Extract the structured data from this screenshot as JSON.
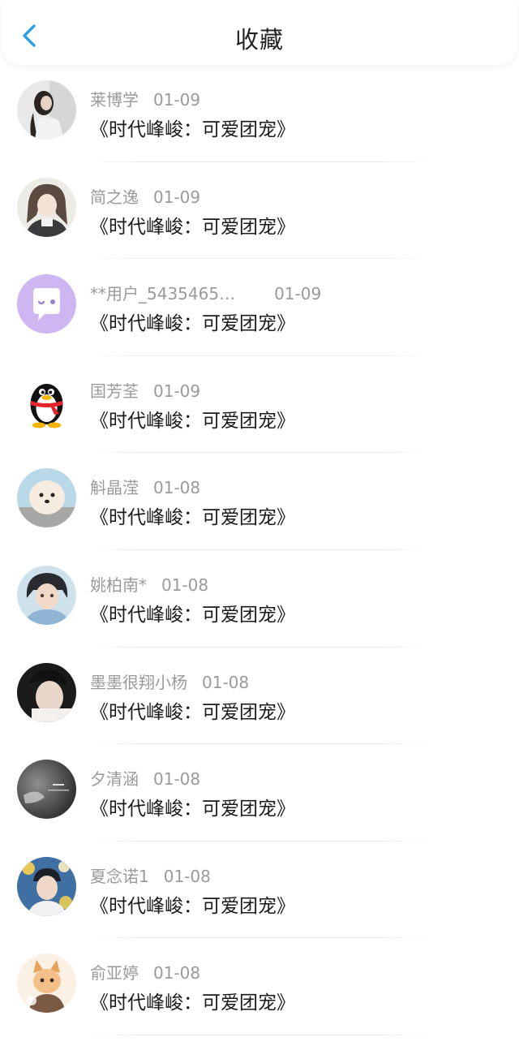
{
  "header": {
    "title": "收藏",
    "back_icon": "chevron-left-icon",
    "accent_color": "#2a9fe8"
  },
  "favorites": [
    {
      "user": "莱博学",
      "date": "01-09",
      "book": "《时代峰峻：可爱团宠》",
      "avatar": "photo-avatar"
    },
    {
      "user": "简之逸",
      "date": "01-09",
      "book": "《时代峰峻：可爱团宠》",
      "avatar": "illustration-avatar"
    },
    {
      "user": "**用户_5435465…",
      "date": "01-09",
      "book": "《时代峰峻：可爱团宠》",
      "avatar": "default-chat-avatar"
    },
    {
      "user": "国芳荃",
      "date": "01-09",
      "book": "《时代峰峻：可爱团宠》",
      "avatar": "penguin-avatar"
    },
    {
      "user": "斛晶滢",
      "date": "01-08",
      "book": "《时代峰峻：可爱团宠》",
      "avatar": "dog-photo-avatar"
    },
    {
      "user": "姚柏南*",
      "date": "01-08",
      "book": "《时代峰峻：可爱团宠》",
      "avatar": "illustration-avatar"
    },
    {
      "user": "墨墨很翔小杨",
      "date": "01-08",
      "book": "《时代峰峻：可爱团宠》",
      "avatar": "photo-avatar"
    },
    {
      "user": "夕清涵",
      "date": "01-08",
      "book": "《时代峰峻：可爱团宠》",
      "avatar": "monochrome-photo-avatar"
    },
    {
      "user": "夏念诺1",
      "date": "01-08",
      "book": "《时代峰峻：可爱团宠》",
      "avatar": "photo-avatar"
    },
    {
      "user": "俞亚婷",
      "date": "01-08",
      "book": "《时代峰峻：可爱团宠》",
      "avatar": "cat-illustration-avatar"
    }
  ]
}
